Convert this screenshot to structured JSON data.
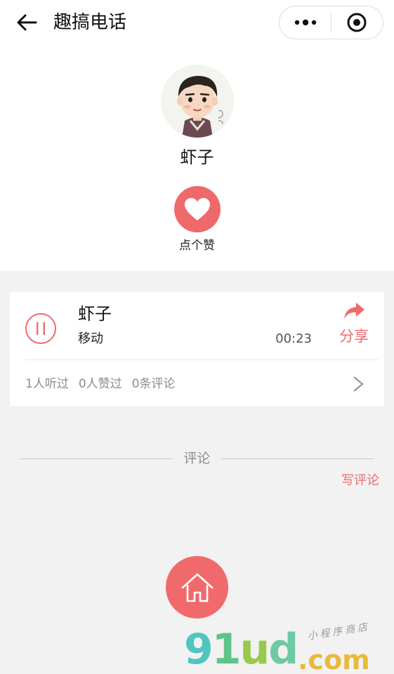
{
  "nav": {
    "title": "趣搞电话",
    "back_icon": "arrow-left-icon",
    "more_icon": "more-dots-icon",
    "close_icon": "target-circle-icon"
  },
  "profile": {
    "avatar_icon": "cartoon-avatar",
    "name": "虾子",
    "like_label": "点个赞",
    "like_icon": "heart-icon"
  },
  "call": {
    "name": "虾子",
    "carrier": "移动",
    "duration": "00:23",
    "share_label": "分享",
    "share_icon": "share-arrow-icon",
    "pause_icon": "pause-icon",
    "stats": {
      "listened": "1人听过",
      "liked": "0人赞过",
      "comments": "0条评论"
    },
    "chevron_icon": "chevron-right-icon"
  },
  "comments": {
    "title": "评论",
    "write_label": "写评论"
  },
  "home": {
    "icon": "home-icon"
  },
  "watermark": {
    "logo": "91ud",
    "domain": ".com",
    "tagline": "小程序商店"
  },
  "colors": {
    "accent": "#f0696a",
    "muted_text": "#8c8c8c",
    "page_bg": "#f2f2f2"
  }
}
